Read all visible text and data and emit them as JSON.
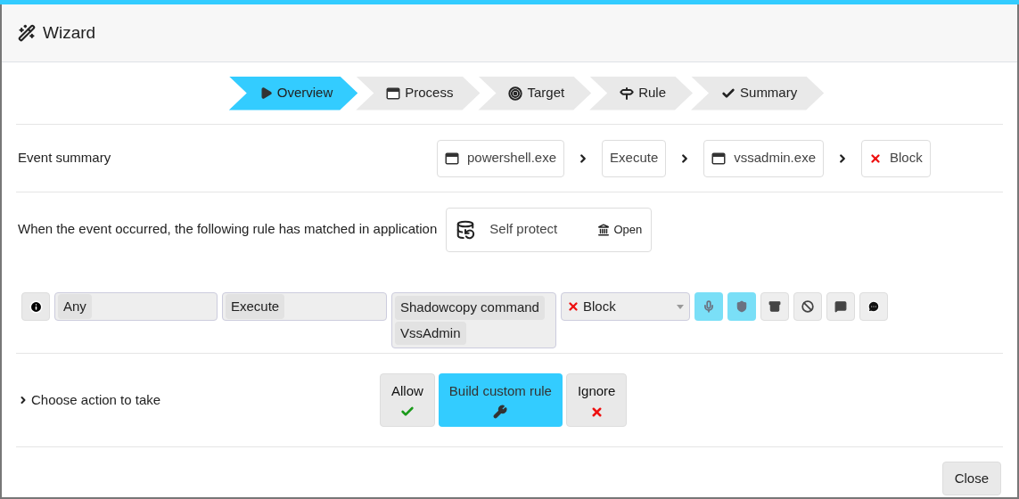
{
  "window": {
    "title": "Wizard"
  },
  "steps": [
    {
      "label": "Overview",
      "selected": true
    },
    {
      "label": "Process",
      "selected": false
    },
    {
      "label": "Target",
      "selected": false
    },
    {
      "label": "Rule",
      "selected": false
    },
    {
      "label": "Summary",
      "selected": false
    }
  ],
  "event_summary": {
    "label": "Event summary",
    "chain": [
      {
        "kind": "process",
        "text": "powershell.exe"
      },
      {
        "kind": "action",
        "text": "Execute"
      },
      {
        "kind": "process",
        "text": "vssadmin.exe"
      },
      {
        "kind": "verdict",
        "text": "Block"
      }
    ]
  },
  "match": {
    "text": "When the event occurred, the following rule has matched in application",
    "application": "Self protect",
    "open_link": "Open"
  },
  "rule": {
    "source": "Any",
    "action": "Execute",
    "targets": [
      "Shadowcopy command",
      "VssAdmin"
    ],
    "verdict": "Block",
    "toggles": [
      {
        "on": true
      },
      {
        "on": true
      },
      {
        "on": false
      },
      {
        "on": false
      },
      {
        "on": false
      },
      {
        "on": false
      }
    ]
  },
  "choose_action": {
    "label": "Choose action to take",
    "options": [
      {
        "label": "Allow",
        "selected": false
      },
      {
        "label": "Build custom rule",
        "selected": true
      },
      {
        "label": "Ignore",
        "selected": false
      }
    ]
  },
  "footer": {
    "close": "Close"
  }
}
